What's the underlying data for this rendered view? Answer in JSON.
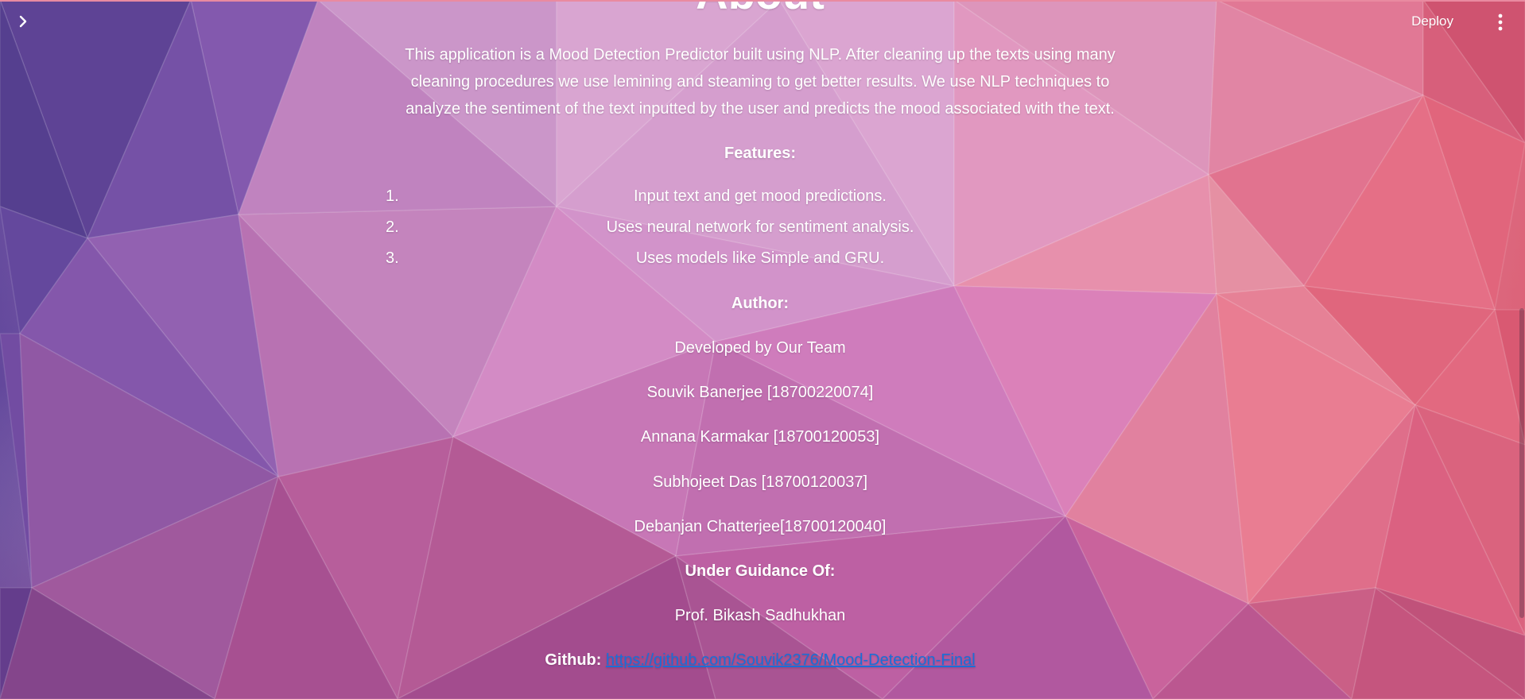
{
  "header": {
    "sidebar_toggle_icon": "chevron-right-icon",
    "deploy_label": "Deploy",
    "menu_icon": "vertical-ellipsis-icon"
  },
  "main": {
    "title": "About",
    "description": "This application is a Mood Detection Predictor built using NLP. After cleaning up the texts using many cleaning procedures we use lemining and steaming to get better results. We use NLP techniques to analyze the sentiment of the text inputted by the user and predicts the mood associated with the text.",
    "features_heading": "Features:",
    "features": [
      {
        "num": "1.",
        "text": "Input text and get mood predictions."
      },
      {
        "num": "2.",
        "text": "Uses neural network for sentiment analysis."
      },
      {
        "num": "3.",
        "text": "Uses models like Simple and GRU."
      }
    ],
    "author_heading": "Author:",
    "developed_by": "Developed by Our Team",
    "team": [
      "Souvik Banerjee [18700220074]",
      "Annana Karmakar [18700120053]",
      "Subhojeet Das [18700120037]",
      "Debanjan Chatterjee[18700120040]"
    ],
    "guidance_heading": "Under Guidance Of:",
    "guide": "Prof. Bikash Sadhukhan",
    "github_label": "Github:",
    "github_url": "https://github.com/Souvik2376/Mood-Detection-Final"
  },
  "colors": {
    "link": "#1a6fd8",
    "text": "#ffffff",
    "top_line": "#e98aa0"
  }
}
